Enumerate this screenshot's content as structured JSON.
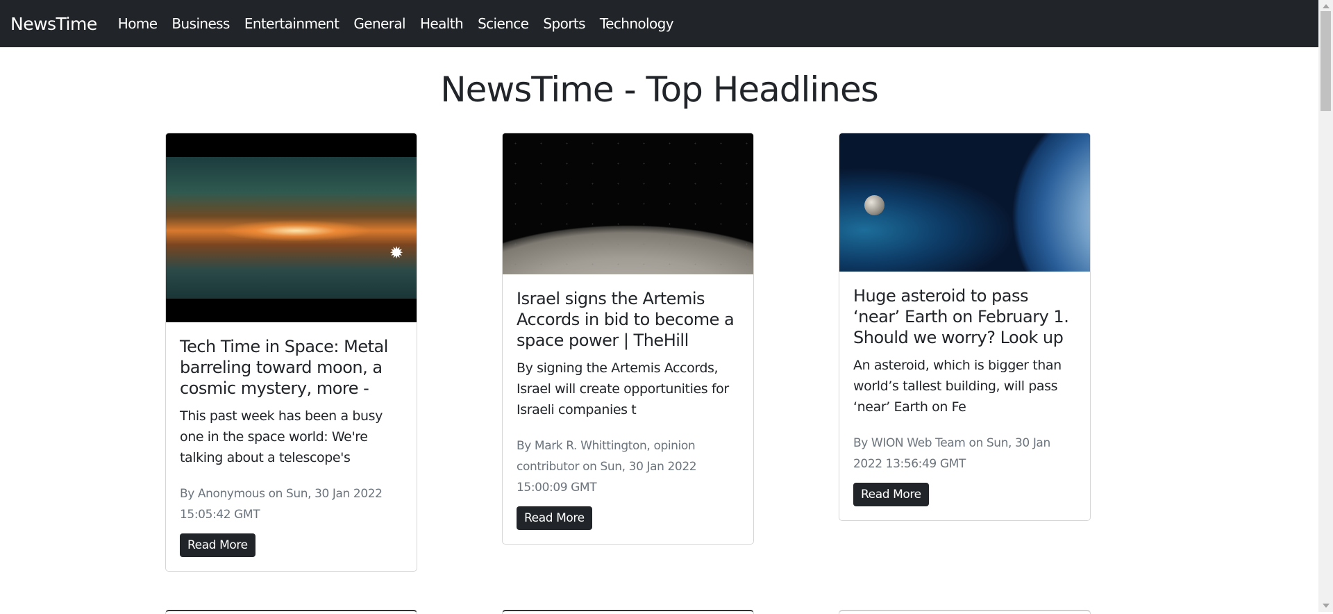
{
  "navbar": {
    "brand": "NewsTime",
    "items": [
      {
        "label": "Home"
      },
      {
        "label": "Business"
      },
      {
        "label": "Entertainment"
      },
      {
        "label": "General"
      },
      {
        "label": "Health"
      },
      {
        "label": "Science"
      },
      {
        "label": "Sports"
      },
      {
        "label": "Technology"
      }
    ]
  },
  "page": {
    "title": "NewsTime - Top Headlines"
  },
  "articles": [
    {
      "title": "Tech Time in Space: Metal barreling toward moon, a cosmic mystery, more -",
      "description": "This past week has been a busy one in the space world: We're talking about a telescope's",
      "meta": "By Anonymous on Sun, 30 Jan 2022 15:05:42 GMT",
      "button_label": "Read More",
      "image_icon": "milky-way-image"
    },
    {
      "title": "Israel signs the Artemis Accords in bid to become a space power | TheHill",
      "description": "By signing the Artemis Accords, Israel will create opportunities for Israeli companies t",
      "meta": "By Mark R. Whittington, opinion contributor on Sun, 30 Jan 2022 15:00:09 GMT",
      "button_label": "Read More",
      "image_icon": "moon-surface-image"
    },
    {
      "title": "Huge asteroid to pass ‘near’ Earth on February 1. Should we worry? Look up",
      "description": "An asteroid, which is bigger than world’s tallest building, will pass ‘near’ Earth on Fe",
      "meta": "By WION Web Team on Sun, 30 Jan 2022 13:56:49 GMT",
      "button_label": "Read More",
      "image_icon": "earth-asteroid-image"
    }
  ],
  "colors": {
    "navbar_bg": "#212529",
    "button_bg": "#212529",
    "meta_text": "#6c757d"
  }
}
